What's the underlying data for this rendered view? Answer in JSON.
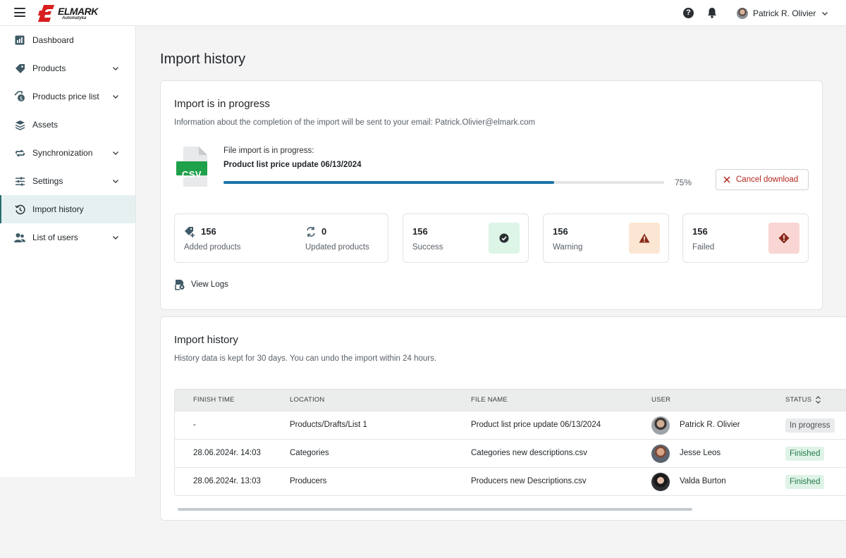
{
  "header": {
    "logo_text": "ELMARK",
    "logo_sub": "Automatyka",
    "help_label": "?",
    "user_name": "Patrick R. Olivier"
  },
  "sidebar": {
    "items": [
      {
        "label": "Dashboard",
        "icon": "chart-icon",
        "expandable": false
      },
      {
        "label": "Products",
        "icon": "tag-icon",
        "expandable": true
      },
      {
        "label": "Products price list",
        "icon": "price-list-icon",
        "expandable": true
      },
      {
        "label": "Assets",
        "icon": "layers-icon",
        "expandable": false
      },
      {
        "label": "Synchronization",
        "icon": "sync-icon",
        "expandable": true
      },
      {
        "label": "Settings",
        "icon": "sliders-icon",
        "expandable": true
      },
      {
        "label": "Import history",
        "icon": "history-icon",
        "expandable": false,
        "active": true
      },
      {
        "label": "List of users",
        "icon": "users-icon",
        "expandable": true
      }
    ]
  },
  "page": {
    "title": "Import history"
  },
  "progress_card": {
    "title": "Import is in progress",
    "subtitle": "Information about the completion of the import will be sent to your email: Patrick.Olivier@elmark.com",
    "file_badge": "CSV",
    "file_caption": "File import is in progress:",
    "file_name": "Product list price update 06/13/2024",
    "progress_value": 75,
    "progress_label": "75%",
    "cancel_label": "Cancel download",
    "stats": {
      "added_value": "156",
      "added_label": "Added products",
      "updated_value": "0",
      "updated_label": "Updated products",
      "success_value": "156",
      "success_label": "Success",
      "warning_value": "156",
      "warning_label": "Warning",
      "failed_value": "156",
      "failed_label": "Failed"
    },
    "view_logs_label": "View Logs"
  },
  "history_card": {
    "title": "Import history",
    "subtitle": "History data is kept for 30 days. You can undo the import within 24 hours.",
    "columns": [
      "FINISH TIME",
      "LOCATION",
      "FILE NAME",
      "USER",
      "STATUS"
    ],
    "rows": [
      {
        "finish_time": "-",
        "location": "Products/Drafts/List 1",
        "file_name": "Product list price update 06/13/2024",
        "user": "Patrick R. Olivier",
        "status": "In progress"
      },
      {
        "finish_time": "28.06.2024r. 14:03",
        "location": "Categories",
        "file_name": "Categories new descriptions.csv",
        "user": "Jesse Leos",
        "status": "Finished"
      },
      {
        "finish_time": "28.06.2024r. 13:03",
        "location": "Producers",
        "file_name": "Producers new Descriptions.csv",
        "user": "Valda Burton",
        "status": "Finished"
      }
    ]
  },
  "colors": {
    "accent": "#1a73a8",
    "danger": "#b3261e",
    "success_bg": "#dcf5e6",
    "warning_bg": "#fbe6d3",
    "failed_bg": "#f9d6d3"
  }
}
